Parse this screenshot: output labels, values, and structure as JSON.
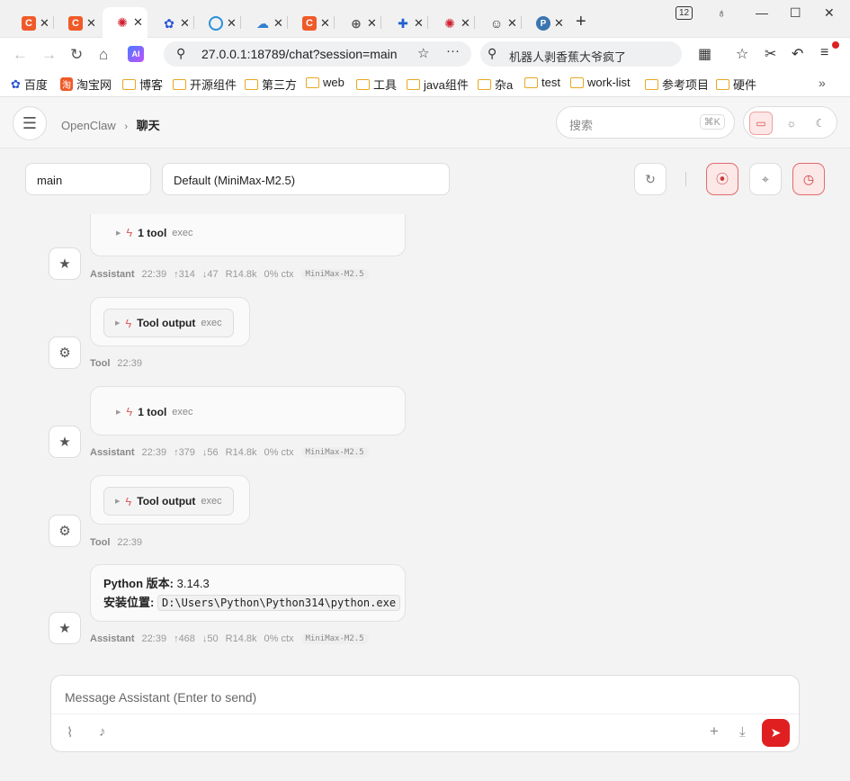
{
  "browser": {
    "tab_count_badge": "12",
    "address": "27.0.0.1:18789/chat?session=main",
    "search_text": "机器人剥香蕉大爷疯了",
    "bookmarks": [
      "百度",
      "淘宝网",
      "博客",
      "开源组件",
      "第三方",
      "web",
      "工具",
      "java组件",
      "杂a",
      "test",
      "work-list",
      "参考项目",
      "硬件"
    ]
  },
  "app": {
    "breadcrumb_root": "OpenClaw",
    "breadcrumb_current": "聊天",
    "search_placeholder": "搜索",
    "search_shortcut": "⌘K",
    "session": "main",
    "model": "Default (MiniMax-M2.5)"
  },
  "messages": [
    {
      "role": "Assistant",
      "tool_label": "1 tool",
      "tool_kind": "exec",
      "time": "22:39",
      "up": "↑314",
      "down": "↓47",
      "ratio": "R14.8k",
      "ctx": "0% ctx",
      "model": "MiniMax-M2.5"
    },
    {
      "role": "Tool",
      "tool_label": "Tool output",
      "tool_kind": "exec",
      "time": "22:39"
    },
    {
      "role": "Assistant",
      "tool_label": "1 tool",
      "tool_kind": "exec",
      "time": "22:39",
      "up": "↑379",
      "down": "↓56",
      "ratio": "R14.8k",
      "ctx": "0% ctx",
      "model": "MiniMax-M2.5"
    },
    {
      "role": "Tool",
      "tool_label": "Tool output",
      "tool_kind": "exec",
      "time": "22:39"
    },
    {
      "role": "Assistant",
      "line1_label": "Python 版本:",
      "line1_value": "3.14.3",
      "line2_label": "安装位置:",
      "line2_value": "D:\\Users\\Python\\Python314\\python.exe",
      "time": "22:39",
      "up": "↑468",
      "down": "↓50",
      "ratio": "R14.8k",
      "ctx": "0% ctx",
      "model": "MiniMax-M2.5"
    }
  ],
  "composer": {
    "placeholder": "Message Assistant (Enter to send)"
  }
}
